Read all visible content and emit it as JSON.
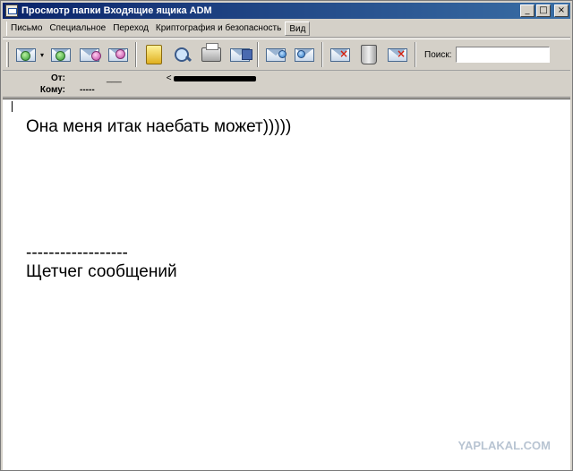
{
  "window": {
    "title": "Просмотр папки Входящие ящика ADM",
    "minimize_glyph": "_",
    "maximize_glyph": "□",
    "close_glyph": "×"
  },
  "menu": {
    "items": [
      "Письмо",
      "Специальное",
      "Переход",
      "Криптография и безопасность",
      "Вид"
    ]
  },
  "toolbar": {
    "dropdown_glyph": "▾",
    "search_label": "Поиск:",
    "search_value": ""
  },
  "header": {
    "from_label": "От:",
    "from_name": "___",
    "from_email_start": "<",
    "to_label": "Кому:",
    "to_value": "-----"
  },
  "message": {
    "line1": "Она меня итак наебать может)))))",
    "signature_separator": "------------------",
    "signature": "Щетчег сообщений"
  },
  "watermark": "YAPLAKAL.COM",
  "colors": {
    "titlebar_start": "#0a246a",
    "titlebar_end": "#3a6ea5",
    "chrome": "#d4d0c8"
  }
}
